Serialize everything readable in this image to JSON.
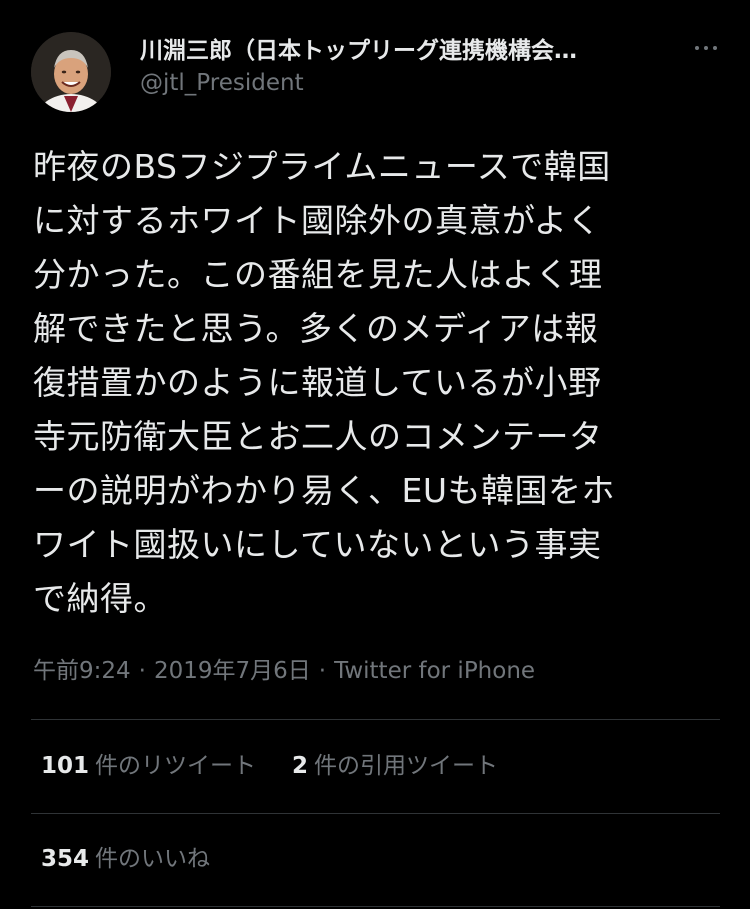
{
  "author": {
    "display_name": "川淵三郎（日本トップリーグ連携機構会…",
    "handle": "@jtl_President"
  },
  "icons": {
    "more": "more-horizontal-icon",
    "avatar": "avatar"
  },
  "tweet": {
    "lines": [
      "昨夜のBSフジプライムニュースで韓国",
      "に対するホワイト國除外の真意がよく",
      "分かった。この番組を見た人はよく理",
      "解できたと思う。多くのメディアは報",
      "復措置かのように報道しているが小野",
      "寺元防衛大臣とお二人のコメンテータ",
      "ーの説明がわかり易く、EUも韓国をホ",
      "ワイト國扱いにしていないという事実",
      "で納得。"
    ]
  },
  "meta": {
    "time": "午前9:24",
    "date": "2019年7月6日",
    "separator": "·",
    "source": "Twitter for iPhone"
  },
  "stats": {
    "retweets_count": "101",
    "retweets_label": "件のリツイート",
    "quotes_count": "2",
    "quotes_label": "件の引用ツイート",
    "likes_count": "354",
    "likes_label": "件のいいね"
  },
  "colors": {
    "background": "#000000",
    "primary_text": "#e7e9ea",
    "secondary_text": "#71767b",
    "divider": "#2f3336"
  }
}
